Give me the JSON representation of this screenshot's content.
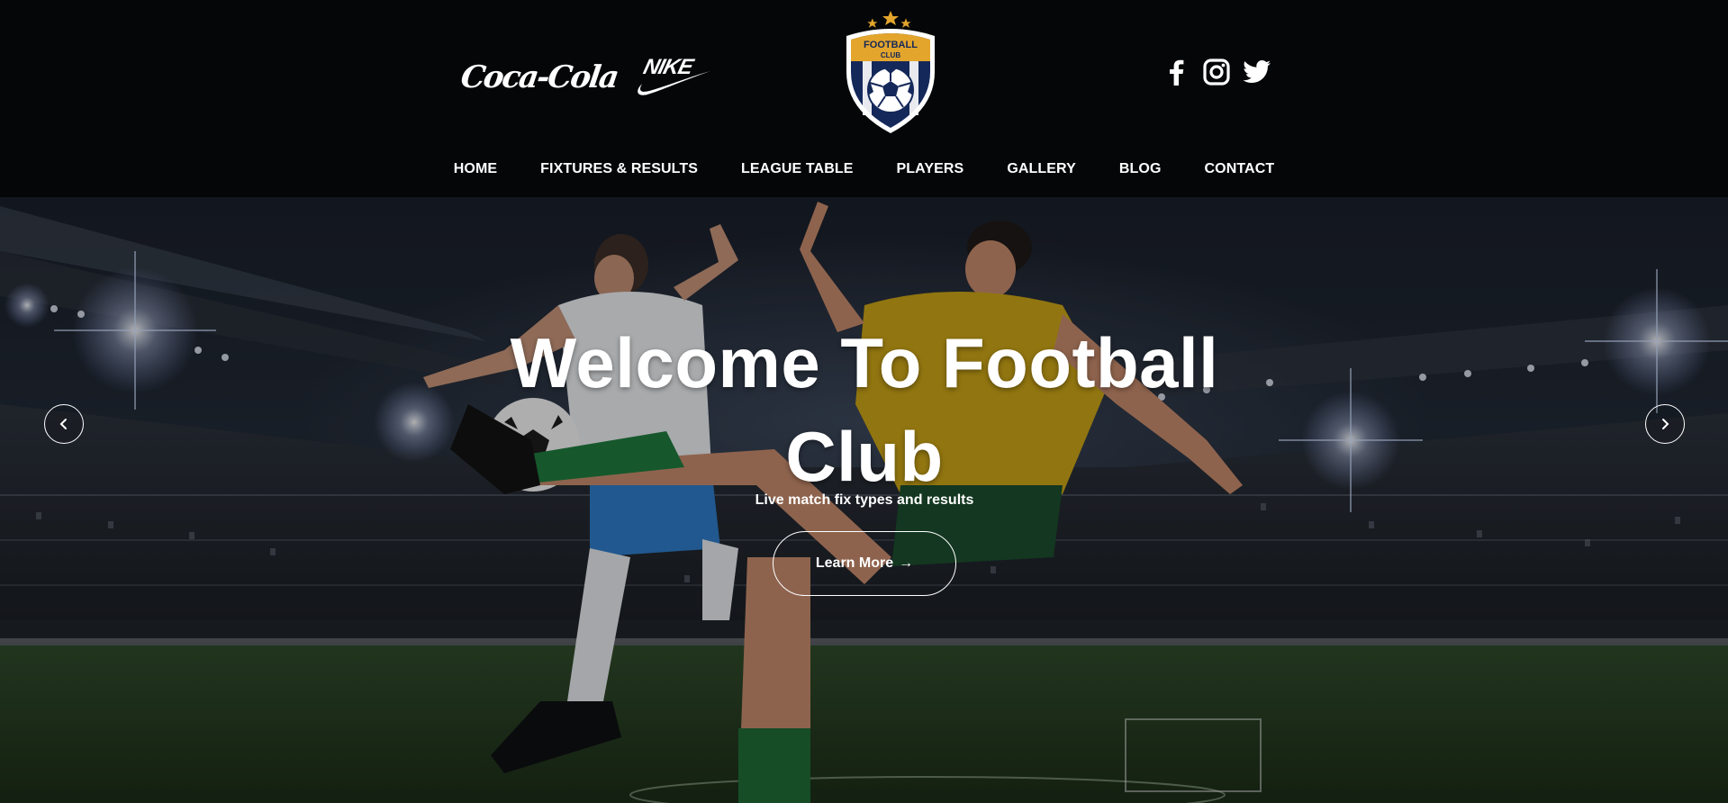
{
  "header": {
    "sponsors": [
      {
        "name": "Coca-Cola",
        "text": "Coca-Cola"
      },
      {
        "name": "Nike",
        "text": "NIKE"
      }
    ],
    "crest": {
      "line1": "FOOTBALL",
      "line2": "CLUB",
      "icon": "football-club-crest"
    },
    "social": [
      {
        "icon": "facebook-icon"
      },
      {
        "icon": "instagram-icon"
      },
      {
        "icon": "twitter-icon"
      }
    ]
  },
  "nav": {
    "items": [
      {
        "label": "HOME"
      },
      {
        "label": "FIXTURES & RESULTS"
      },
      {
        "label": "LEAGUE TABLE"
      },
      {
        "label": "PLAYERS"
      },
      {
        "label": "GALLERY"
      },
      {
        "label": "BLOG"
      },
      {
        "label": "CONTACT"
      }
    ]
  },
  "hero": {
    "title": "Welcome To Football Club",
    "subtitle": "Live match fix types and results",
    "cta_label": "Learn More",
    "cta_arrow": "→",
    "prev_icon": "chevron-left-icon",
    "next_icon": "chevron-right-icon"
  },
  "colors": {
    "header_bg": "#050608",
    "crest_gold": "#e3a52c",
    "crest_navy": "#14285a",
    "text": "#ffffff"
  }
}
